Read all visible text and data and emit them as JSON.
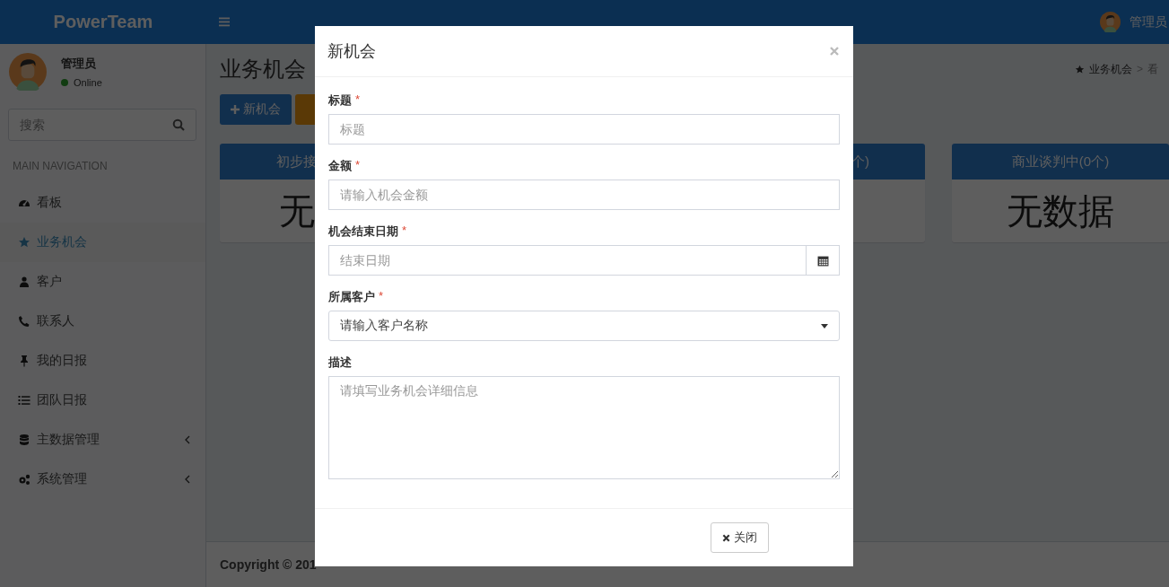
{
  "header": {
    "logo": "PowerTeam",
    "user_name": "管理员"
  },
  "sidebar": {
    "user": {
      "name": "管理员",
      "status": "Online"
    },
    "search": {
      "placeholder": "搜索"
    },
    "section_title": "MAIN NAVIGATION",
    "items": [
      {
        "label": "看板",
        "selected": false,
        "expandable": false
      },
      {
        "label": "业务机会",
        "selected": true,
        "expandable": false
      },
      {
        "label": "客户",
        "selected": false,
        "expandable": false
      },
      {
        "label": "联系人",
        "selected": false,
        "expandable": false
      },
      {
        "label": "我的日报",
        "selected": false,
        "expandable": false
      },
      {
        "label": "团队日报",
        "selected": false,
        "expandable": false
      },
      {
        "label": "主数据管理",
        "selected": false,
        "expandable": true
      },
      {
        "label": "系统管理",
        "selected": false,
        "expandable": true
      }
    ]
  },
  "content": {
    "title": "业务机会",
    "breadcrumb": [
      "业务机会",
      "看"
    ],
    "breadcrumb_separator": ">",
    "new_button": "新机会",
    "kanban": [
      {
        "header": "初步接",
        "body": "无"
      },
      {
        "header": "个)"
      },
      {
        "header": "商业谈判中(0个)",
        "body": "无数据"
      }
    ]
  },
  "footer": {
    "copyright": "Copyright © 201"
  },
  "modal": {
    "title": "新机会",
    "fields": [
      {
        "kind": "text",
        "label": "标题",
        "required_mark": "*",
        "placeholder": "标题"
      },
      {
        "kind": "text",
        "label": "金额",
        "required_mark": "*",
        "placeholder": "请输入机会金额"
      },
      {
        "kind": "date",
        "label": "机会结束日期",
        "required_mark": "*",
        "placeholder": "结束日期"
      },
      {
        "kind": "select",
        "label": "所属客户",
        "required_mark": "*",
        "placeholder": "请输入客户名称"
      },
      {
        "kind": "textarea",
        "label": "描述",
        "placeholder": "请填写业务机会详细信息"
      }
    ],
    "buttons": [
      "关闭"
    ]
  }
}
